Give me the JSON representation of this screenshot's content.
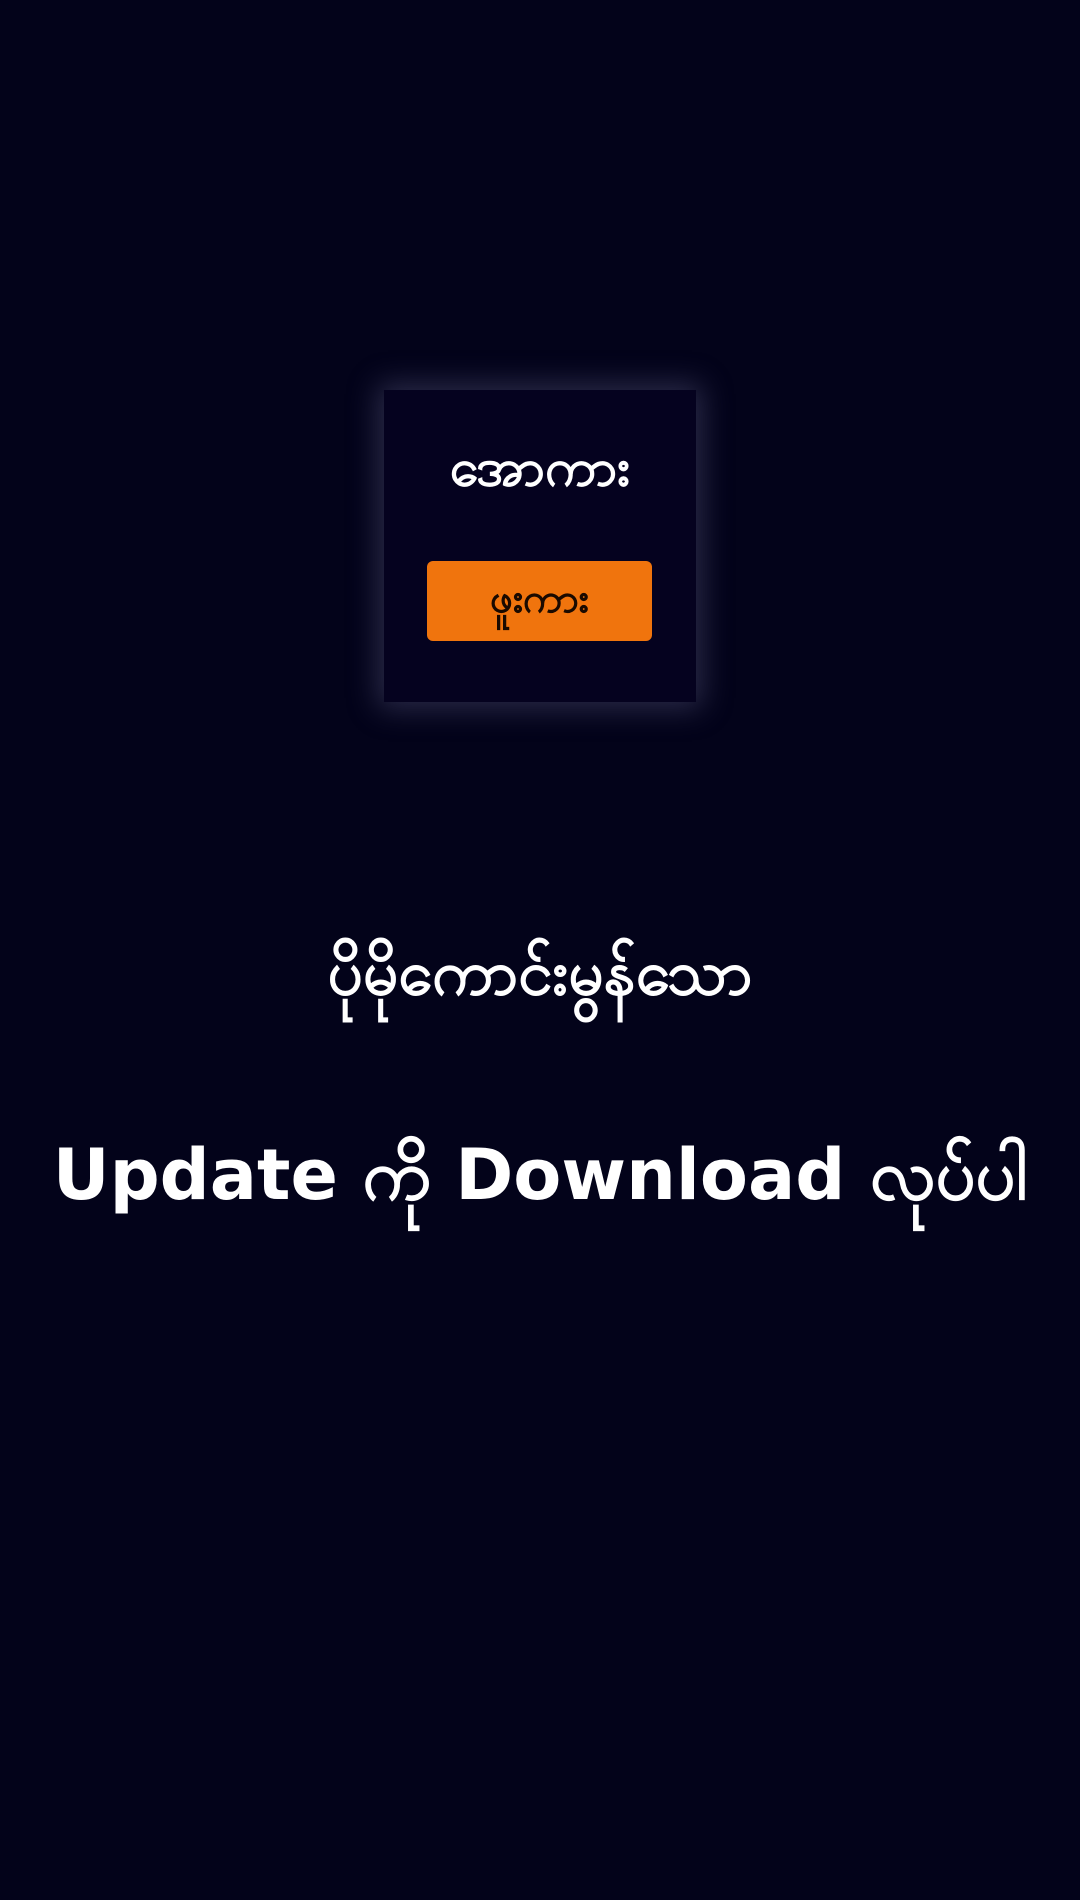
{
  "logo": {
    "title": "အောကား",
    "badge": "ဖူးကား"
  },
  "message": {
    "headline": "ပိုမိုကောင်းမွန်သော",
    "action": "Update ကို Download လုပ်ပါ"
  },
  "colors": {
    "background": "#03031a",
    "logo_background": "#05021f",
    "badge": "#f0740d",
    "text": "#ffffff"
  }
}
